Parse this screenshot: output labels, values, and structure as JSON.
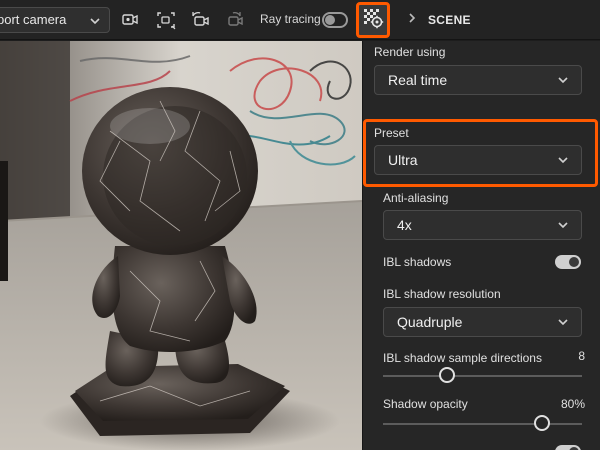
{
  "toolbar": {
    "camera_select": "port camera",
    "ray_tracing_label": "Ray tracing",
    "ray_tracing_on": false,
    "breadcrumb": "SCENE"
  },
  "panel": {
    "render_using": {
      "label": "Render using",
      "value": "Real time"
    },
    "preset": {
      "label": "Preset",
      "value": "Ultra"
    },
    "anti_aliasing": {
      "label": "Anti-aliasing",
      "value": "4x"
    },
    "ibl_shadows": {
      "label": "IBL shadows",
      "on": true
    },
    "ibl_shadow_resolution": {
      "label": "IBL shadow resolution",
      "value": "Quadruple"
    },
    "ibl_shadow_sample_directions": {
      "label": "IBL shadow sample directions",
      "value": "8"
    },
    "shadow_opacity": {
      "label": "Shadow opacity",
      "value": "80%"
    }
  },
  "slider_levels": {
    "ibl_shadow_sample_directions": 0.32,
    "shadow_opacity": 0.8
  },
  "colors": {
    "highlight": "#ff5a00",
    "panel": "#262626",
    "toolbar": "#232323"
  },
  "icons": [
    "chevron-down-icon",
    "camera-add-icon",
    "frame-camera-icon",
    "undo-camera-icon",
    "redo-camera-icon",
    "render-settings-icon",
    "chevron-right-icon"
  ]
}
